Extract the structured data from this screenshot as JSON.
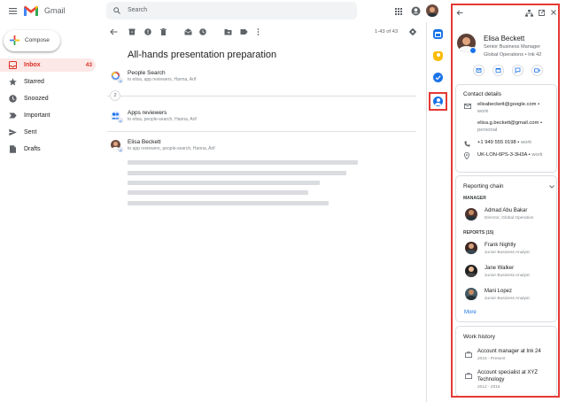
{
  "header": {
    "app_name": "Gmail",
    "search_placeholder": "Search"
  },
  "compose": {
    "label": "Compose"
  },
  "sidebar": {
    "items": [
      {
        "label": "Inbox",
        "count": "43"
      },
      {
        "label": "Starred"
      },
      {
        "label": "Snoozed"
      },
      {
        "label": "Important"
      },
      {
        "label": "Sent"
      },
      {
        "label": "Drafts"
      }
    ]
  },
  "toolbar": {
    "page_info": "1-43 of 43"
  },
  "thread": {
    "subject": "All-hands presentation preparation",
    "collapsed_count": "2",
    "messages": [
      {
        "sender": "People Search",
        "recipients": "to elisa, app reviewers, Hanna, Arif"
      },
      {
        "sender": "Apps reviewers",
        "recipients": "to elisa, people-search, Hanna, Arif"
      },
      {
        "sender": "Elisa Beckett",
        "recipients": "to app reviewers, people-search, Hanna, Arif"
      }
    ]
  },
  "contact_panel": {
    "name": "Elisa Beckett",
    "title": "Senior Business Manager",
    "location": "Global Operations • Ink 42",
    "contact_details": {
      "heading": "Contact details",
      "email1": "elisabeckett@google.com •",
      "email1_type": "work",
      "email2": "elisa.g.beckett@gmail.com •",
      "email2_type": "personal",
      "phone": "+1 949 555 0198 •",
      "phone_type": "work",
      "address": "UK-LON-6PS-3-3H3A •",
      "address_type": "work"
    },
    "reporting_chain": {
      "heading": "Reporting chain",
      "manager_label": "MANAGER",
      "manager": {
        "name": "Admad Abu Bakar",
        "role": "Director, Global Operation"
      },
      "reports_label": "REPORTS (15)",
      "reports": [
        {
          "name": "Frank Nightly",
          "role": "Junior Business Analyst"
        },
        {
          "name": "Jane Walker",
          "role": "Junior Business Analyst"
        },
        {
          "name": "Mani Lopez",
          "role": "Junior Business Analyst"
        }
      ],
      "more_label": "More"
    },
    "work_history": {
      "heading": "Work history",
      "items": [
        {
          "title": "Account manager at Ink 24",
          "period": "2016 - Present"
        },
        {
          "title": "Account specialist at XYZ",
          "title2": "Technology",
          "period": "2012 - 2016"
        }
      ]
    }
  },
  "colors": {
    "accent_red": "#d93025",
    "highlight_red": "#e53935",
    "blue": "#1a73e8"
  }
}
